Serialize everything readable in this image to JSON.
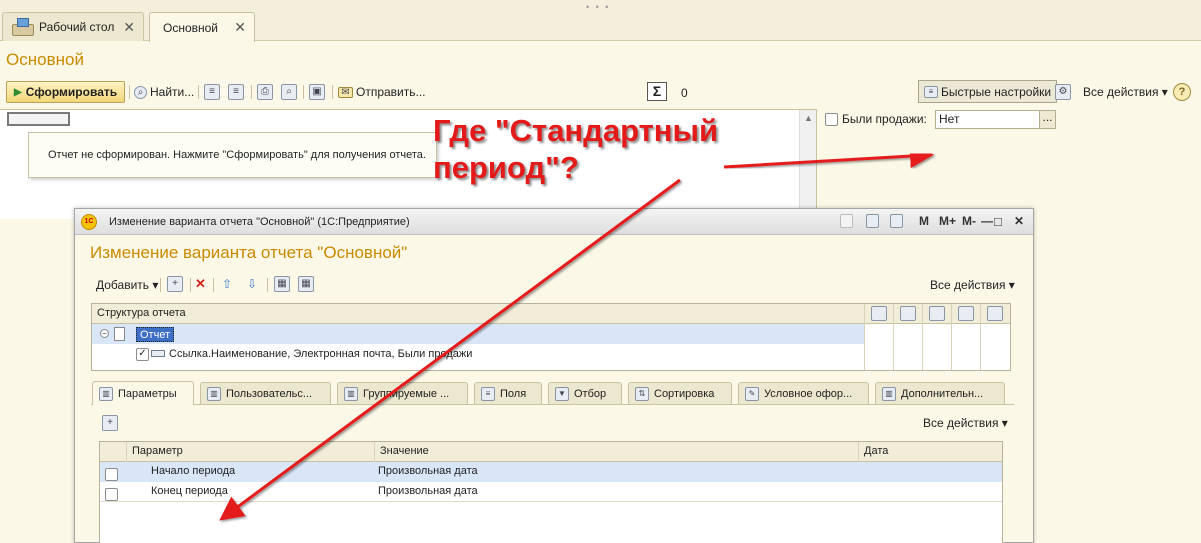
{
  "tabs": [
    {
      "label": "Рабочий стол"
    },
    {
      "label": "Основной"
    }
  ],
  "tab_close_glyph": "✕",
  "page_title": "Основной",
  "toolbar": {
    "generate_label": "Сформировать",
    "find_label": "Найти...",
    "send_label": "Отправить...",
    "sigma_symbol": "Σ",
    "sigma_value": "0",
    "quick_settings_label": "Быстрые настройки",
    "all_actions_label": "Все действия ▾",
    "help_glyph": "?"
  },
  "report": {
    "notice": "Отчет не сформирован. Нажмите \"Сформировать\" для получения отчета."
  },
  "filter": {
    "sold_label": "Были продажи:",
    "sold_value": "Нет",
    "dots": "..."
  },
  "annotation": {
    "line1": "Где \"Стандартный",
    "line2": "период\"?"
  },
  "dialog": {
    "window_title": "Изменение варианта отчета \"Основной\"  (1С:Предприятие)",
    "title": "Изменение варианта отчета \"Основной\"",
    "add_label": "Добавить ▾",
    "all_actions_label": "Все действия ▾",
    "window_buttons": [
      "M",
      "M+",
      "M-",
      "—",
      "□",
      "✕"
    ],
    "structure": {
      "header": "Структура отчета",
      "root_node": "Отчет",
      "row_text": "Ссылка.Наименование, Электронная почта, Были продажи"
    },
    "tabs": [
      {
        "label": "Параметры"
      },
      {
        "label": "Пользовательс..."
      },
      {
        "label": "Группируемые ..."
      },
      {
        "label": "Поля"
      },
      {
        "label": "Отбор"
      },
      {
        "label": "Сортировка"
      },
      {
        "label": "Условное офор..."
      },
      {
        "label": "Дополнительн..."
      }
    ],
    "params_all_actions": "Все действия ▾",
    "params": {
      "columns": [
        "Параметр",
        "Значение",
        "Дата"
      ],
      "rows": [
        {
          "param": "Начало периода",
          "value": "Произвольная дата",
          "date": ""
        },
        {
          "param": "Конец периода",
          "value": "Произвольная дата",
          "date": ""
        }
      ]
    }
  },
  "colors": {
    "accent_title": "#c98a00",
    "annotation": "#e41a1a",
    "selection": "#d9e6f7"
  }
}
